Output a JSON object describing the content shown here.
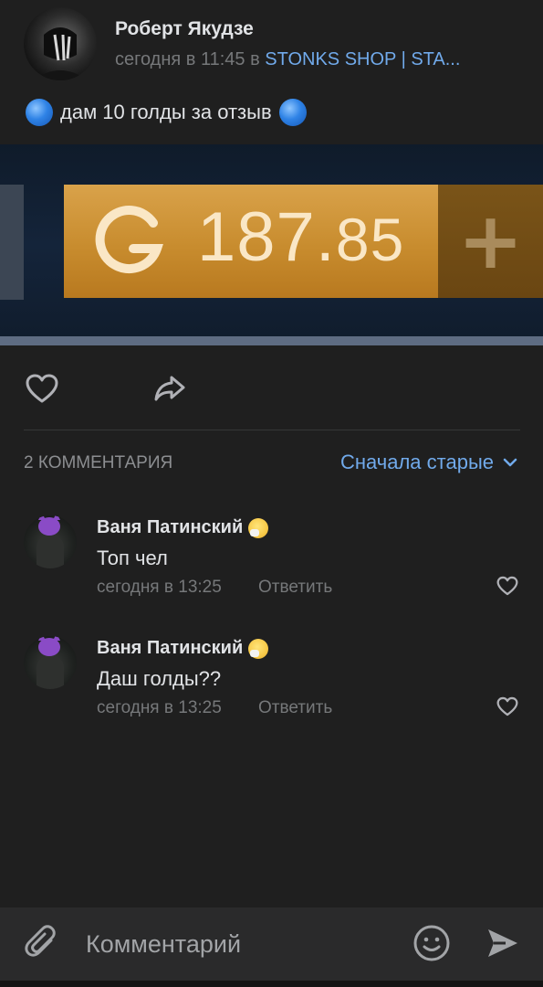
{
  "post": {
    "author": "Роберт Якудзе",
    "time": "сегодня в 11:45 в",
    "group": "STONKS SHOP | STA...",
    "text": "дам 10 голды за отзыв",
    "image": {
      "gold_amount_main": "187.",
      "gold_amount_decimal": "85",
      "plus": "+"
    }
  },
  "comments_section": {
    "count_label": "2 КОММЕНТАРИЯ",
    "sort_label": "Сначала старые"
  },
  "comments": [
    {
      "author": "Ваня Патинский",
      "text": "Топ чел",
      "time": "сегодня в 13:25",
      "reply": "Ответить"
    },
    {
      "author": "Ваня Патинский",
      "text": "Даш голды??",
      "time": "сегодня в 13:25",
      "reply": "Ответить"
    }
  ],
  "composer": {
    "placeholder": "Комментарий"
  },
  "colors": {
    "background": "#1f1f1f",
    "accent": "#71aaeb",
    "gold": "#c88c2e",
    "muted": "#76787a"
  },
  "icons": [
    "heart-icon",
    "share-icon",
    "chevron-down-icon",
    "attach-icon",
    "emoji-icon",
    "send-icon",
    "sneeze-emoji-icon"
  ]
}
